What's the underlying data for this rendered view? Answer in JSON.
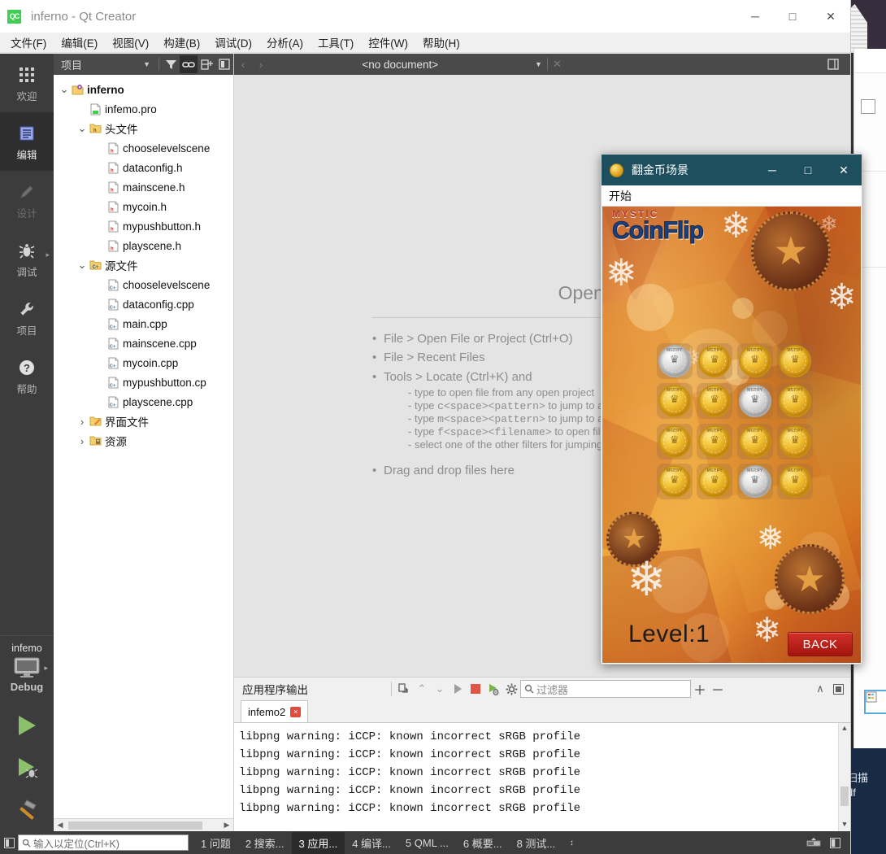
{
  "window": {
    "title": "inferno - Qt Creator",
    "app_icon": "qt-creator-icon",
    "minimize": "─",
    "maximize": "□",
    "close": "✕"
  },
  "menubar": {
    "items": [
      {
        "label": "文件(F)"
      },
      {
        "label": "编辑(E)"
      },
      {
        "label": "视图(V)"
      },
      {
        "label": "构建(B)"
      },
      {
        "label": "调试(D)"
      },
      {
        "label": "分析(A)"
      },
      {
        "label": "工具(T)"
      },
      {
        "label": "控件(W)"
      },
      {
        "label": "帮助(H)"
      }
    ]
  },
  "modebar": {
    "items": [
      {
        "label": "欢迎",
        "icon": "grid-icon",
        "state": "normal"
      },
      {
        "label": "编辑",
        "icon": "document-icon",
        "state": "active"
      },
      {
        "label": "设计",
        "icon": "pencil-icon",
        "state": "disabled"
      },
      {
        "label": "调试",
        "icon": "bug-icon",
        "state": "normal"
      },
      {
        "label": "项目",
        "icon": "wrench-icon",
        "state": "normal"
      },
      {
        "label": "帮助",
        "icon": "question-icon",
        "state": "normal"
      }
    ],
    "kit": {
      "project": "infemo",
      "config": "Debug",
      "icon": "monitor-icon"
    },
    "run_buttons": [
      {
        "name": "run-button",
        "icon": "play-icon"
      },
      {
        "name": "debug-button",
        "icon": "play-debug-icon"
      },
      {
        "name": "build-button",
        "icon": "hammer-icon"
      }
    ]
  },
  "project_pane": {
    "combo_value": "项目",
    "toolbar_icons": [
      "filter-icon",
      "link-icon",
      "split-add-icon",
      "sidebar-toggle-icon"
    ],
    "tree": [
      {
        "indent": 0,
        "twisty": "∨",
        "icon": "project-icon",
        "label": "inferno",
        "bold": true
      },
      {
        "indent": 1,
        "twisty": "",
        "icon": "pro-file-icon",
        "label": "infemo.pro",
        "bold": false
      },
      {
        "indent": 1,
        "twisty": "∨",
        "icon": "folder-h-icon",
        "label": "头文件",
        "bold": false
      },
      {
        "indent": 2,
        "twisty": "",
        "icon": "header-file-icon",
        "label": "chooselevelscene",
        "bold": false
      },
      {
        "indent": 2,
        "twisty": "",
        "icon": "header-file-icon",
        "label": "dataconfig.h",
        "bold": false
      },
      {
        "indent": 2,
        "twisty": "",
        "icon": "header-file-icon",
        "label": "mainscene.h",
        "bold": false
      },
      {
        "indent": 2,
        "twisty": "",
        "icon": "header-file-icon",
        "label": "mycoin.h",
        "bold": false
      },
      {
        "indent": 2,
        "twisty": "",
        "icon": "header-file-icon",
        "label": "mypushbutton.h",
        "bold": false
      },
      {
        "indent": 2,
        "twisty": "",
        "icon": "header-file-icon",
        "label": "playscene.h",
        "bold": false
      },
      {
        "indent": 1,
        "twisty": "∨",
        "icon": "folder-cpp-icon",
        "label": "源文件",
        "bold": false
      },
      {
        "indent": 2,
        "twisty": "",
        "icon": "cpp-file-icon",
        "label": "chooselevelscene",
        "bold": false
      },
      {
        "indent": 2,
        "twisty": "",
        "icon": "cpp-file-icon",
        "label": "dataconfig.cpp",
        "bold": false
      },
      {
        "indent": 2,
        "twisty": "",
        "icon": "cpp-file-icon",
        "label": "main.cpp",
        "bold": false
      },
      {
        "indent": 2,
        "twisty": "",
        "icon": "cpp-file-icon",
        "label": "mainscene.cpp",
        "bold": false
      },
      {
        "indent": 2,
        "twisty": "",
        "icon": "cpp-file-icon",
        "label": "mycoin.cpp",
        "bold": false
      },
      {
        "indent": 2,
        "twisty": "",
        "icon": "cpp-file-icon",
        "label": "mypushbutton.cp",
        "bold": false
      },
      {
        "indent": 2,
        "twisty": "",
        "icon": "cpp-file-icon",
        "label": "playscene.cpp",
        "bold": false
      },
      {
        "indent": 1,
        "twisty": "›",
        "icon": "folder-ui-icon",
        "label": "界面文件",
        "bold": false
      },
      {
        "indent": 1,
        "twisty": "›",
        "icon": "folder-res-icon",
        "label": "资源",
        "bold": false
      }
    ]
  },
  "editor": {
    "doc_title": "<no document>",
    "back_icon": "chevron-left-icon",
    "forward_icon": "chevron-right-icon",
    "close_icon": "close-icon",
    "split_icon": "split-icon",
    "welcome": {
      "heading": "Open a document",
      "bullets": [
        "File > Open File or Project (Ctrl+O)",
        "File > Recent Files",
        "Tools > Locate (Ctrl+K) and"
      ],
      "sub_items": [
        {
          "pre": "type to open file from any open project",
          "code": "",
          "post": ""
        },
        {
          "pre": "type ",
          "code": "c<space><pattern>",
          "post": " to jump to a class definition"
        },
        {
          "pre": "type ",
          "code": "m<space><pattern>",
          "post": " to jump to a method"
        },
        {
          "pre": "type ",
          "code": "f<space><filename>",
          "post": " to open file"
        },
        {
          "pre": "select one of the other filters for jumping to a location",
          "code": "",
          "post": ""
        }
      ],
      "last_bullet": "Drag and drop files here"
    }
  },
  "output_pane": {
    "title": "应用程序输出",
    "toolbar_icons": [
      "attach-icon",
      "prev-icon",
      "next-icon",
      "run-icon",
      "stop-icon",
      "run-debug-icon",
      "gear-icon"
    ],
    "filter_placeholder": "过滤器",
    "filter_icon": "search-icon",
    "zoom_in": "＋",
    "zoom_out": "－",
    "minimize_icon": "∧",
    "maximize_icon": "▣",
    "tabs": [
      {
        "label": "infemo2",
        "close": "×",
        "active": true
      }
    ],
    "lines": [
      "libpng warning: iCCP: known incorrect sRGB profile",
      "libpng warning: iCCP: known incorrect sRGB profile",
      "libpng warning: iCCP: known incorrect sRGB profile",
      "libpng warning: iCCP: known incorrect sRGB profile",
      "libpng warning: iCCP: known incorrect sRGB profile"
    ]
  },
  "statusbar": {
    "sidebar_icon": "sidebar-icon",
    "locator_placeholder": "输入以定位(Ctrl+K)",
    "locator_icon": "search-icon",
    "items": [
      {
        "label": "1 问题",
        "active": false
      },
      {
        "label": "2 搜索...",
        "active": false
      },
      {
        "label": "3 应用...",
        "active": true
      },
      {
        "label": "4 编译...",
        "active": false
      },
      {
        "label": "5 QML ...",
        "active": false
      },
      {
        "label": "6 概要...",
        "active": false
      },
      {
        "label": "8 测试...",
        "active": false
      }
    ],
    "updown": "↕",
    "right_icons": [
      "progress-icon",
      "output-toggle-icon"
    ]
  },
  "game_window": {
    "title": "翻金币场景",
    "icon": "gold-coin-icon",
    "minimize": "─",
    "maximize": "□",
    "close": "✕",
    "menu": [
      {
        "label": "开始"
      }
    ],
    "logo": {
      "top": "MYSTIC",
      "main": "CoinFlip"
    },
    "level_label": "Level:1",
    "back_button": "BACK",
    "grid": {
      "rows": 4,
      "cols": 4,
      "coin_face_symbol": "♛",
      "coin_ring_text": "MERRY CHRISTMAS",
      "cells": [
        [
          "silver",
          "gold",
          "gold",
          "gold"
        ],
        [
          "gold",
          "gold",
          "silver",
          "gold"
        ],
        [
          "gold",
          "gold",
          "gold",
          "gold"
        ],
        [
          "gold",
          "gold",
          "silver",
          "gold"
        ]
      ]
    }
  },
  "background": {
    "taskbar_note_line1": "扫描",
    "taskbar_note_line2": "df"
  },
  "colors": {
    "accent_teal": "#1d4f5e",
    "qt_green": "#41cd52",
    "back_red": "#b71c12",
    "modebar_bg": "#3c3c3c",
    "toolbar_bg": "#4a4a4a",
    "editor_bg": "#e4e4e4"
  }
}
